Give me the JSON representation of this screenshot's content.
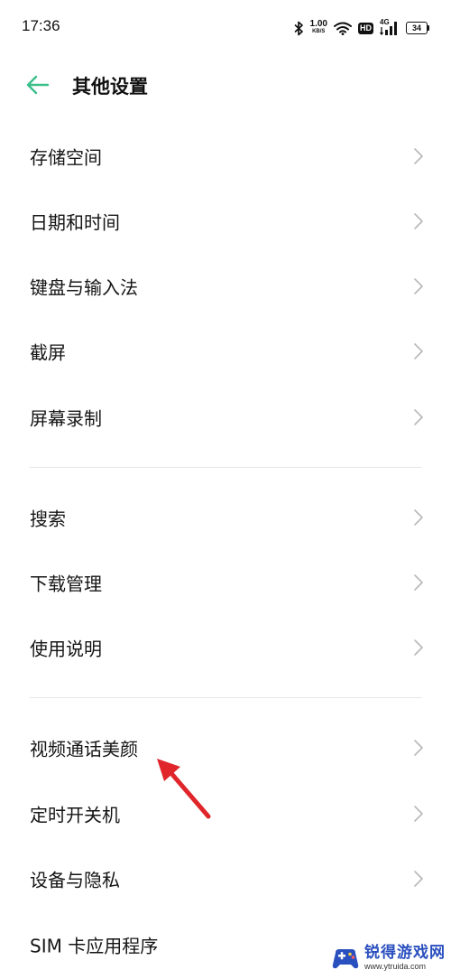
{
  "status_bar": {
    "time": "17:36",
    "net_speed_value": "1.00",
    "net_speed_unit": "KB/S",
    "hd_label": "HD",
    "signal_label": "4G",
    "battery_level": "34",
    "icons": [
      "bluetooth-icon",
      "wifi-icon",
      "cellular-signal-icon",
      "battery-icon"
    ]
  },
  "header": {
    "back_icon": "back-arrow-icon",
    "title": "其他设置",
    "accent_color": "#3bbf8a"
  },
  "groups": [
    {
      "items": [
        {
          "label": "存储空间"
        },
        {
          "label": "日期和时间"
        },
        {
          "label": "键盘与输入法"
        },
        {
          "label": "截屏"
        },
        {
          "label": "屏幕录制"
        }
      ]
    },
    {
      "items": [
        {
          "label": "搜索"
        },
        {
          "label": "下载管理"
        },
        {
          "label": "使用说明"
        }
      ]
    },
    {
      "items": [
        {
          "label": "视频通话美颜"
        },
        {
          "label": "定时开关机"
        },
        {
          "label": "设备与隐私"
        },
        {
          "label": "SIM 卡应用程序"
        }
      ]
    }
  ],
  "annotation": {
    "arrow_color": "#e0262a",
    "points_to": "视频通话美颜"
  },
  "watermark": {
    "name": "锐得游戏网",
    "url": "www.ytruida.com"
  }
}
